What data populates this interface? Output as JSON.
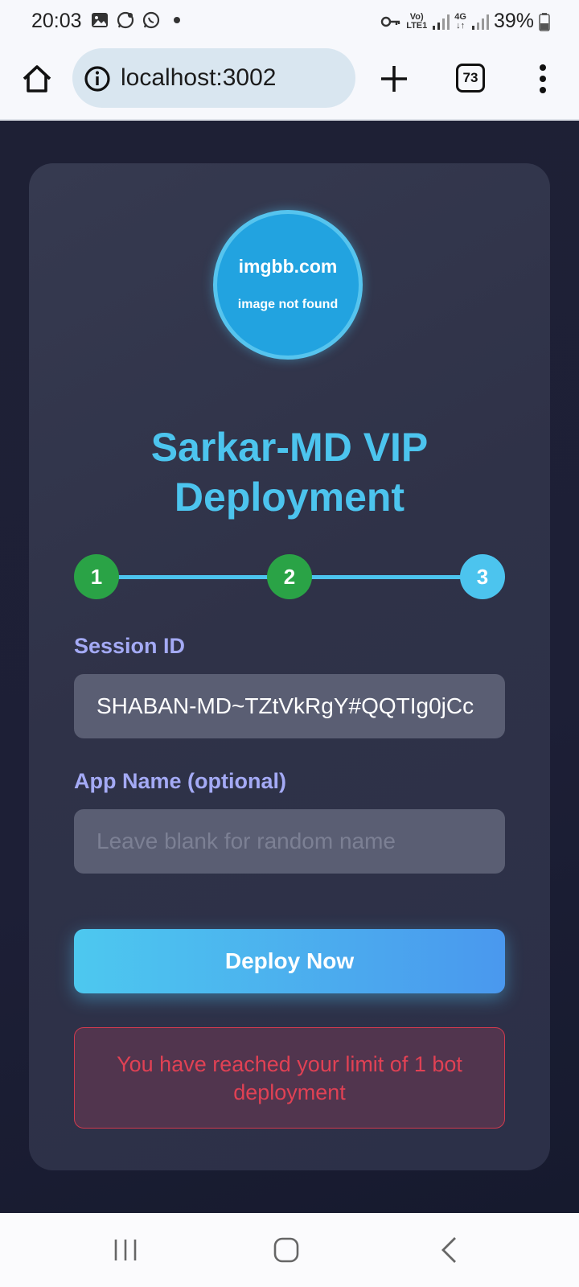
{
  "status_bar": {
    "time": "20:03",
    "network_top": "Vo)",
    "network_bottom": "LTE1",
    "network_type_top": "4G",
    "network_type_bottom": "↓↑",
    "battery": "39%"
  },
  "browser": {
    "url": "localhost:3002",
    "tab_count": "73"
  },
  "card": {
    "avatar_line1": "imgbb.com",
    "avatar_line2": "image not found",
    "title": "Sarkar-MD VIP Deployment",
    "steps": [
      "1",
      "2",
      "3"
    ],
    "current_step": 3,
    "session_label": "Session ID",
    "session_value": "SHABAN-MD~TZtVkRgY#QQTIg0jCc",
    "app_name_label": "App Name (optional)",
    "app_name_placeholder": "Leave blank for random name",
    "deploy_label": "Deploy Now",
    "error": "You have reached your limit of 1 bot deployment"
  },
  "colors": {
    "accent": "#4cc4ee",
    "step_done": "#2aa346",
    "error": "#e04154",
    "label": "#a4aaf5"
  },
  "icons": {
    "home": "home-icon",
    "info": "info-icon",
    "new_tab": "plus-icon",
    "menu": "more-vertical-icon",
    "recents": "recents-icon",
    "home_nav": "home-nav-icon",
    "back": "back-icon"
  }
}
